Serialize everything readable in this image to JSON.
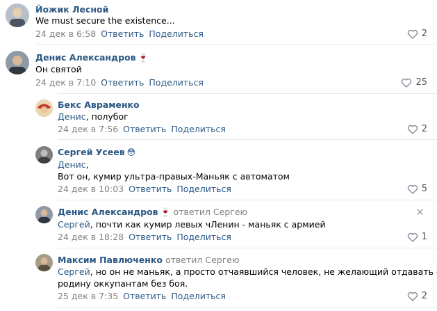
{
  "comments": [
    {
      "author": "Йожик Лесной",
      "emoji": "",
      "replied": "",
      "mention": "",
      "lines": [
        "We must secure the existence..."
      ],
      "date": "24 дек в 6:58",
      "reply_label": "Ответить",
      "share_label": "Поделиться",
      "likes": "2"
    },
    {
      "author": "Денис Александров",
      "emoji": "🍷",
      "replied": "",
      "mention": "",
      "lines": [
        "Он святой"
      ],
      "date": "24 дек в 7:10",
      "reply_label": "Ответить",
      "share_label": "Поделиться",
      "likes": "25"
    },
    {
      "author": "Бекс Авраменко",
      "emoji": "",
      "replied": "",
      "mention": "Денис",
      "lines": [
        ", полубог"
      ],
      "date": "24 дек в 7:56",
      "reply_label": "Ответить",
      "share_label": "Поделиться",
      "likes": "2"
    },
    {
      "author": "Сергей Усеев",
      "emoji": "😳",
      "replied": "",
      "mention": "Денис",
      "lines": [
        ",",
        "Вот он, кумир ультра-правых-Маньяк с автоматом"
      ],
      "date": "24 дек в 10:03",
      "reply_label": "Ответить",
      "share_label": "Поделиться",
      "likes": "5"
    },
    {
      "author": "Денис Александров",
      "emoji": "🍷",
      "replied": "ответил Сергею",
      "mention": "Сергей",
      "lines": [
        ", почти как кумир левых чЛенин - маньяк с армией"
      ],
      "date": "24 дек в 18:28",
      "reply_label": "Ответить",
      "share_label": "Поделиться",
      "likes": "1"
    },
    {
      "author": "Максим Павлюченко",
      "emoji": "",
      "replied": "ответил Сергею",
      "mention": "Сергей",
      "lines": [
        ", но он не маньяк, а просто отчаявшийся человек, не желающий отдавать свою",
        "родину оккупантам без боя."
      ],
      "date": "25 дек в 7:35",
      "reply_label": "Ответить",
      "share_label": "Поделиться",
      "likes": "2"
    }
  ],
  "colors": {
    "link": "#2a5885",
    "meta": "#828282",
    "divider": "#e7e8ec"
  },
  "icons": {
    "like": "heart-icon",
    "close": "close-icon"
  }
}
